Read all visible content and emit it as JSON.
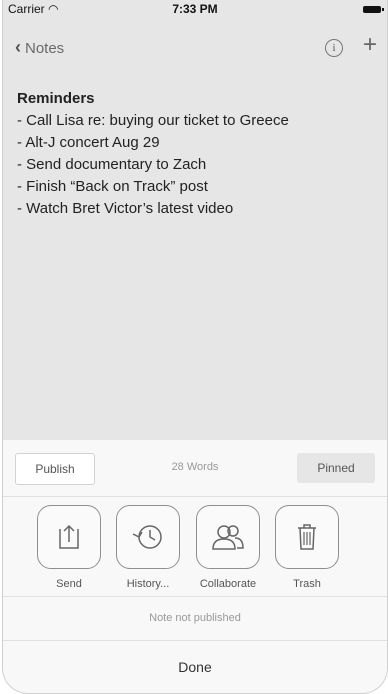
{
  "status_bar": {
    "carrier": "Carrier",
    "time": "7:33 PM"
  },
  "nav": {
    "back_label": "Notes",
    "info_symbol": "i",
    "add_symbol": "+"
  },
  "note": {
    "lines": [
      "Reminders",
      "- Call Lisa re: buying our ticket to Greece",
      "- Alt-J concert Aug 29",
      "- Send documentary to Zach",
      "- Finish “Back on Track” post",
      "- Watch Bret Victor’s latest video"
    ]
  },
  "sheet": {
    "publish_label": "Publish",
    "word_count": "28 Words",
    "pinned_label": "Pinned",
    "actions": [
      {
        "label": "Send",
        "icon": "share-icon"
      },
      {
        "label": "History...",
        "icon": "history-icon"
      },
      {
        "label": "Collaborate",
        "icon": "collaborate-icon"
      },
      {
        "label": "Trash",
        "icon": "trash-icon"
      }
    ],
    "publish_status": "Note not published",
    "done_label": "Done"
  }
}
